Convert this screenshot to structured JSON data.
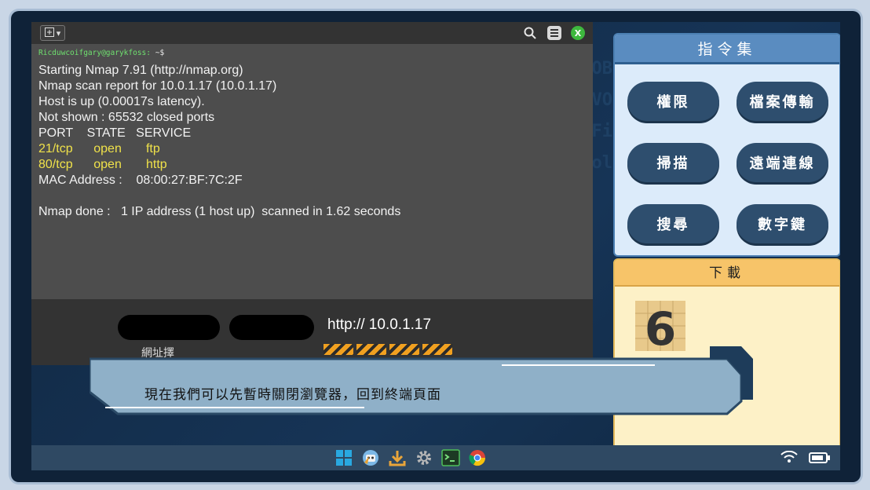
{
  "terminal": {
    "prompt_user": "Ricduwcoifgary@garykfoss:",
    "prompt_path": "~$",
    "lines": [
      {
        "text": "Starting Nmap 7.91 (http://nmap.org)",
        "color": "#f2f2f2"
      },
      {
        "text": "Nmap scan report for 10.0.1.17 (10.0.1.17)",
        "color": "#f2f2f2"
      },
      {
        "text": "Host is up (0.00017s latency).",
        "color": "#f2f2f2"
      },
      {
        "text": "Not shown : 65532 closed ports",
        "color": "#f2f2f2"
      },
      {
        "text": "PORT    STATE   SERVICE",
        "color": "#f2f2f2"
      },
      {
        "text": "21/tcp      open       ftp",
        "color": "#f0e24a"
      },
      {
        "text": "80/tcp      open       http",
        "color": "#f0e24a"
      },
      {
        "text": "MAC Address :    08:00:27:BF:7C:2F",
        "color": "#f2f2f2"
      },
      {
        "text": " ",
        "color": "#f2f2f2"
      },
      {
        "text": "Nmap done :   1 IP address (1 host up)  scanned in 1.62 seconds",
        "color": "#f2f2f2"
      }
    ],
    "icons": [
      "new-tab-icon",
      "search-icon",
      "menu-icon",
      "close-icon"
    ],
    "close_label": "X"
  },
  "browser": {
    "url": "http:// 10.0.1.17",
    "url_label": "網址擇"
  },
  "commands": {
    "title": "指令集",
    "buttons": [
      "權限",
      "檔案傳輸",
      "掃描",
      "遠端連線",
      "搜尋",
      "數字鍵"
    ]
  },
  "download": {
    "title": "下載",
    "item_digit": "6"
  },
  "subtitle": {
    "text": "現在我們可以先暫時關閉瀏覽器，回到終端頁面"
  },
  "taskbar": {
    "icons": [
      "windows-icon",
      "robot-icon",
      "download-icon",
      "settings-icon",
      "terminal-icon",
      "chrome-icon"
    ],
    "tray": [
      "wifi-icon",
      "battery-icon"
    ]
  },
  "colors": {
    "terminal_bg": "#4d4d4d",
    "highlight": "#f0e24a",
    "command_button": "#2e4e6e",
    "download_bg": "#fdf1c7"
  }
}
